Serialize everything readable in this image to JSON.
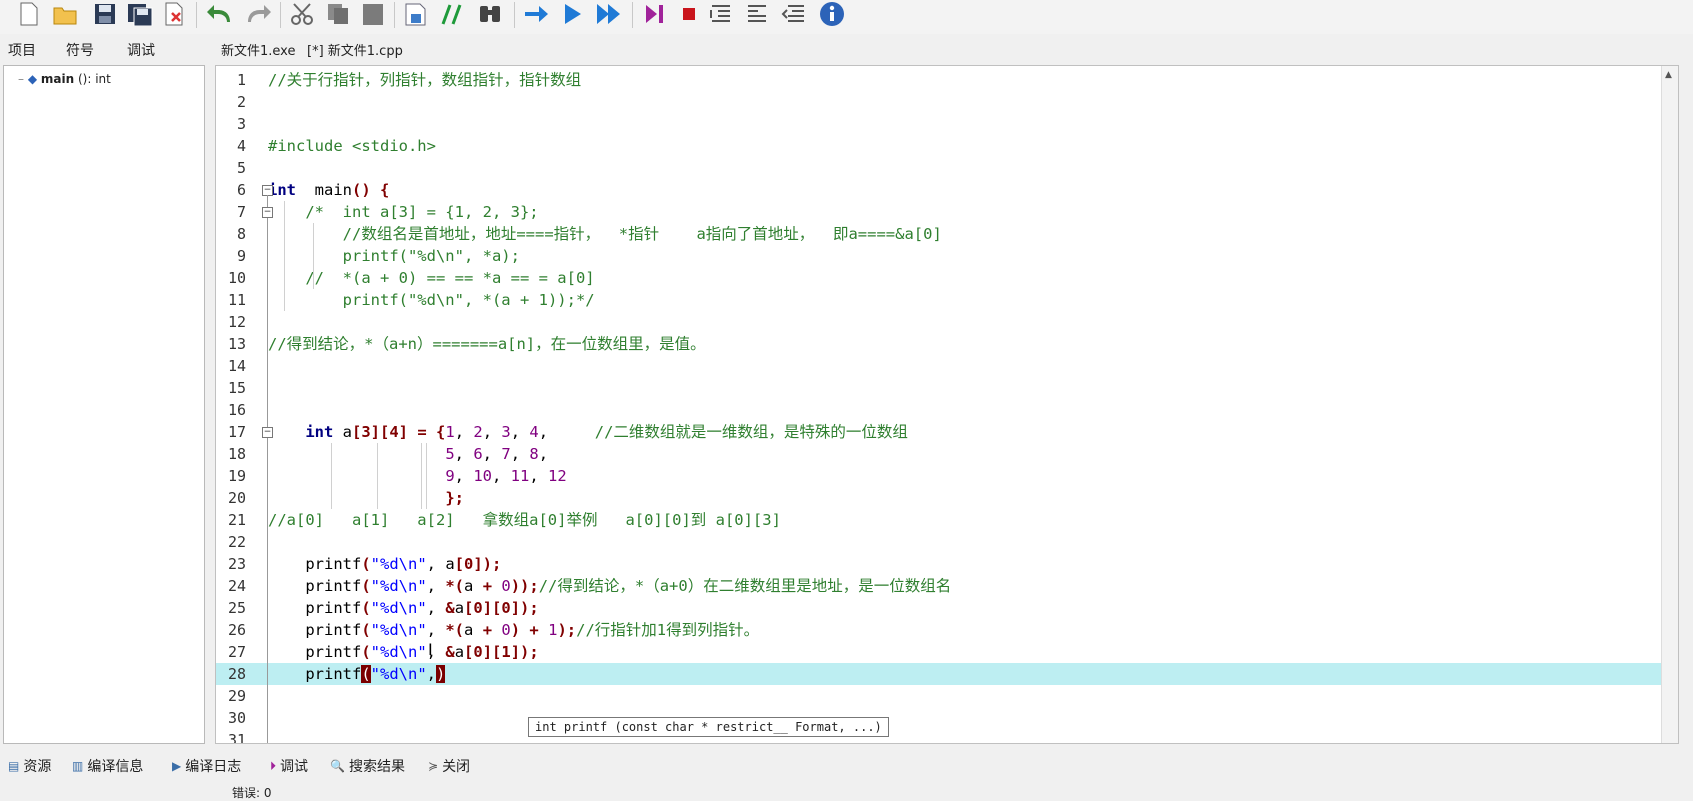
{
  "toolbar": {
    "buttons": [
      "new-file",
      "open-file",
      "save",
      "save-all",
      "close-file",
      "undo",
      "redo",
      "cut",
      "copy",
      "paste",
      "indent",
      "comment",
      "find",
      "compile",
      "run",
      "compile-run",
      "debug",
      "stop",
      "insert-line",
      "toggle-comment",
      "uncomment",
      "about"
    ]
  },
  "left_panel": {
    "tabs": [
      "项目",
      "符号",
      "调试"
    ],
    "tree": {
      "name": "main",
      "signature": " (): int"
    }
  },
  "file_tabs": [
    "新文件1.exe",
    "[*] 新文件1.cpp"
  ],
  "editor": {
    "current_line": 28,
    "lines": [
      {
        "n": "1",
        "segs": [
          [
            "cm",
            "//关于行指针，列指针，数组指针，指针数组"
          ]
        ]
      },
      {
        "n": "2",
        "segs": []
      },
      {
        "n": "3",
        "segs": []
      },
      {
        "n": "4",
        "segs": [
          [
            "cm",
            "#include <stdio.h>"
          ]
        ]
      },
      {
        "n": "5",
        "segs": []
      },
      {
        "n": "6",
        "segs": [
          [
            "kw",
            "int"
          ],
          [
            "",
            "  main"
          ],
          [
            "sym",
            "()"
          ],
          [
            "",
            " "
          ],
          [
            "sym",
            "{"
          ]
        ]
      },
      {
        "n": "7",
        "segs": [
          [
            "",
            "    "
          ],
          [
            "cm",
            "/*  int a[3] = {1, 2, 3};"
          ]
        ]
      },
      {
        "n": "8",
        "segs": [
          [
            "",
            "        "
          ],
          [
            "cm",
            "//数组名是首地址，地址====指针，  *指针    a指向了首地址，  即a====&a[0]"
          ]
        ]
      },
      {
        "n": "9",
        "segs": [
          [
            "",
            "        "
          ],
          [
            "cm",
            "printf(\"%d\\n\", *a);"
          ]
        ]
      },
      {
        "n": "10",
        "segs": [
          [
            "",
            "    "
          ],
          [
            "cm",
            "//  *(a + 0) == == *a == = a[0]"
          ]
        ]
      },
      {
        "n": "11",
        "segs": [
          [
            "",
            "        "
          ],
          [
            "cm",
            "printf(\"%d\\n\", *(a + 1));*/"
          ]
        ]
      },
      {
        "n": "12",
        "segs": []
      },
      {
        "n": "13",
        "segs": [
          [
            "cm",
            "//得到结论，*（a+n）=======a[n]，在一位数组里，是值。"
          ]
        ]
      },
      {
        "n": "14",
        "segs": []
      },
      {
        "n": "15",
        "segs": []
      },
      {
        "n": "16",
        "segs": []
      },
      {
        "n": "17",
        "segs": [
          [
            "",
            "    "
          ],
          [
            "kw",
            "int"
          ],
          [
            "",
            " a"
          ],
          [
            "sym",
            "[3][4]"
          ],
          [
            "",
            " "
          ],
          [
            "sym",
            "="
          ],
          [
            "",
            " "
          ],
          [
            "sym",
            "{"
          ],
          [
            "num",
            "1"
          ],
          [
            "",
            ", "
          ],
          [
            "num",
            "2"
          ],
          [
            "",
            ", "
          ],
          [
            "num",
            "3"
          ],
          [
            "",
            ", "
          ],
          [
            "num",
            "4"
          ],
          [
            "",
            ",     "
          ],
          [
            "cm",
            "//二维数组就是一维数组，是特殊的一位数组"
          ]
        ]
      },
      {
        "n": "18",
        "segs": [
          [
            "",
            "                   "
          ],
          [
            "num",
            "5"
          ],
          [
            "",
            ", "
          ],
          [
            "num",
            "6"
          ],
          [
            "",
            ", "
          ],
          [
            "num",
            "7"
          ],
          [
            "",
            ", "
          ],
          [
            "num",
            "8"
          ],
          [
            "",
            ","
          ]
        ]
      },
      {
        "n": "19",
        "segs": [
          [
            "",
            "                   "
          ],
          [
            "num",
            "9"
          ],
          [
            "",
            ", "
          ],
          [
            "num",
            "10"
          ],
          [
            "",
            ", "
          ],
          [
            "num",
            "11"
          ],
          [
            "",
            ", "
          ],
          [
            "num",
            "12"
          ]
        ]
      },
      {
        "n": "20",
        "segs": [
          [
            "",
            "                   "
          ],
          [
            "sym",
            "};"
          ]
        ]
      },
      {
        "n": "21",
        "segs": [
          [
            "cm",
            "//a[0]   a[1]   a[2]   拿数组a[0]举例   a[0][0]到 a[0][3]"
          ]
        ]
      },
      {
        "n": "22",
        "segs": []
      },
      {
        "n": "23",
        "segs": [
          [
            "",
            "    printf"
          ],
          [
            "sym",
            "("
          ],
          [
            "str",
            "\"%d\\n\""
          ],
          [
            "",
            ", a"
          ],
          [
            "sym",
            "[0]);"
          ]
        ]
      },
      {
        "n": "24",
        "segs": [
          [
            "",
            "    printf"
          ],
          [
            "sym",
            "("
          ],
          [
            "str",
            "\"%d\\n\""
          ],
          [
            "",
            ", "
          ],
          [
            "sym",
            "*("
          ],
          [
            "",
            "a "
          ],
          [
            "sym",
            "+"
          ],
          [
            "",
            " "
          ],
          [
            "num",
            "0"
          ],
          [
            "sym",
            "));"
          ],
          [
            "cm",
            "//得到结论，*（a+0）在二维数组里是地址，是一位数组名"
          ]
        ]
      },
      {
        "n": "25",
        "segs": [
          [
            "",
            "    printf"
          ],
          [
            "sym",
            "("
          ],
          [
            "str",
            "\"%d\\n\""
          ],
          [
            "",
            ", "
          ],
          [
            "sym",
            "&"
          ],
          [
            "",
            "a"
          ],
          [
            "sym",
            "[0][0]);"
          ]
        ]
      },
      {
        "n": "26",
        "segs": [
          [
            "",
            "    printf"
          ],
          [
            "sym",
            "("
          ],
          [
            "str",
            "\"%d\\n\""
          ],
          [
            "",
            ", "
          ],
          [
            "sym",
            "*("
          ],
          [
            "",
            "a "
          ],
          [
            "sym",
            "+"
          ],
          [
            "",
            " "
          ],
          [
            "num",
            "0"
          ],
          [
            "sym",
            ")"
          ],
          [
            "",
            " "
          ],
          [
            "sym",
            "+"
          ],
          [
            "",
            " "
          ],
          [
            "num",
            "1"
          ],
          [
            "sym",
            ");"
          ],
          [
            "cm",
            "//行指针加1得到列指针。"
          ]
        ]
      },
      {
        "n": "27",
        "segs": [
          [
            "",
            "    printf"
          ],
          [
            "sym",
            "("
          ],
          [
            "str",
            "\"%d\\n\""
          ],
          [
            "",
            ", "
          ],
          [
            "sym",
            "&"
          ],
          [
            "",
            "a"
          ],
          [
            "sym",
            "[0][1]);"
          ]
        ]
      },
      {
        "n": "28",
        "segs": [
          [
            "",
            "    printf"
          ],
          [
            "bracket",
            "("
          ],
          [
            "str",
            "\"%d\\n\""
          ],
          [
            "",
            ","
          ],
          [
            "bracket",
            ")"
          ]
        ]
      },
      {
        "n": "29",
        "segs": []
      },
      {
        "n": "30",
        "segs": []
      },
      {
        "n": "31",
        "segs": []
      }
    ],
    "hint": "int printf (const char * restrict__ Format, ...)"
  },
  "bottom": {
    "tabs": [
      {
        "icon": "▤",
        "label": "资源"
      },
      {
        "icon": "▥",
        "label": "编译信息"
      },
      {
        "icon": "▶",
        "label": "编译日志"
      },
      {
        "icon": "⏵",
        "label": "调试"
      },
      {
        "icon": "🔍",
        "label": "搜索结果"
      },
      {
        "icon": "≽",
        "label": "关闭"
      }
    ],
    "status": "错误: 0"
  }
}
